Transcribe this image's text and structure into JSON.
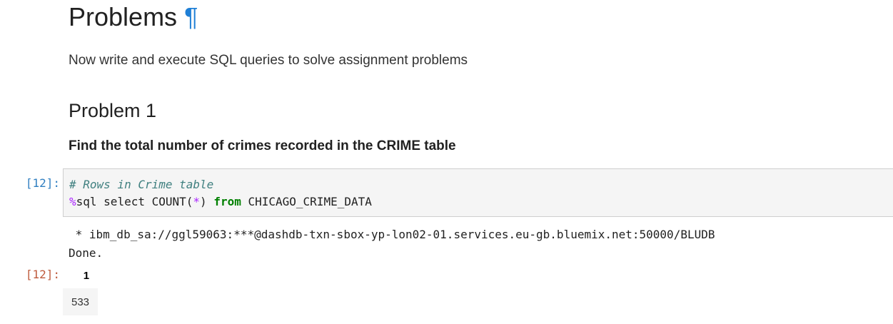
{
  "heading": {
    "title": "Problems",
    "anchor": "¶"
  },
  "intro_text": "Now write and execute SQL queries to solve assignment problems",
  "problem": {
    "title": "Problem 1",
    "task": "Find the total number of crimes recorded in the CRIME table"
  },
  "cell": {
    "input_prompt": "[12]:",
    "output_prompt": "[12]:",
    "code": {
      "comment": "# Rows in Crime table",
      "magic": "%",
      "line2_a": "sql select COUNT(",
      "star": "*",
      "line2_b": ") ",
      "keyword": "from",
      "line2_c": " CHICAGO_CRIME_DATA"
    },
    "stdout": {
      "line1": " * ibm_db_sa://ggl59063:***@dashdb-txn-sbox-yp-lon02-01.services.eu-gb.bluemix.net:50000/BLUDB",
      "line2": "Done."
    },
    "result": {
      "column_header": "1",
      "value": "533"
    }
  },
  "colors": {
    "anchor": "#1e7fd6",
    "input_prompt": "#307fc1",
    "output_prompt": "#bf5b3d",
    "comment": "#408080",
    "keyword": "#008000",
    "magic": "#aa22ff"
  }
}
